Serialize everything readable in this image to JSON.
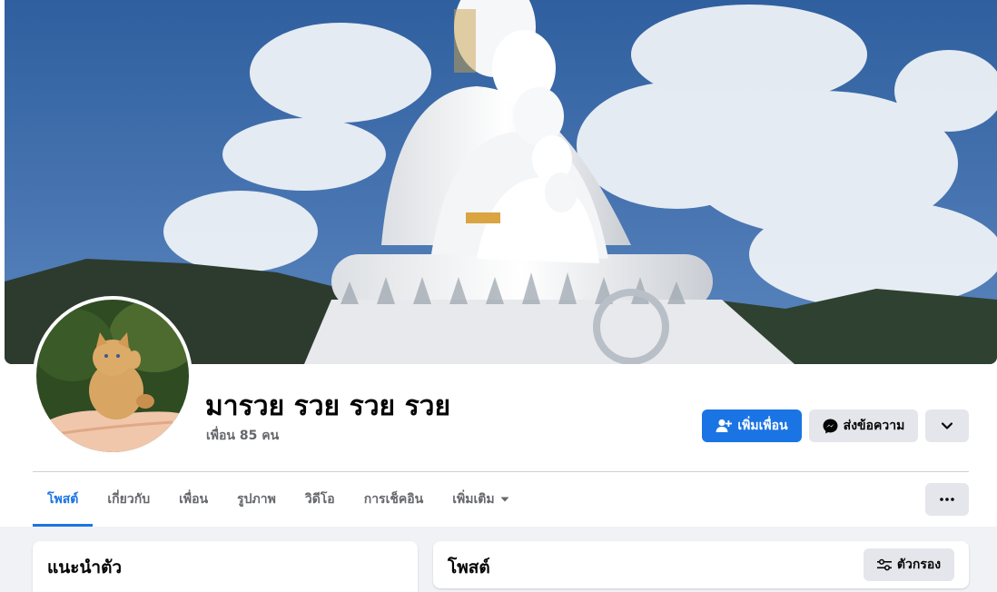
{
  "profile": {
    "name": "มารวย รวย รวย รวย",
    "friends": "เพื่อน 85 คน"
  },
  "actions": {
    "add_friend": "เพิ่มเพื่อน",
    "message": "ส่งข้อความ"
  },
  "tabs": [
    {
      "label": "โพสต์",
      "active": true
    },
    {
      "label": "เกี่ยวกับ",
      "active": false
    },
    {
      "label": "เพื่อน",
      "active": false
    },
    {
      "label": "รูปภาพ",
      "active": false
    },
    {
      "label": "วิดีโอ",
      "active": false
    },
    {
      "label": "การเช็คอิน",
      "active": false
    },
    {
      "label": "เพิ่มเติม",
      "active": false
    }
  ],
  "intro": {
    "title": "แนะนำตัว"
  },
  "posts": {
    "title": "โพสต์",
    "filter_label": "ตัวกรอง"
  },
  "colors": {
    "accent": "#1b74e4",
    "secondary_button": "#e4e6eb",
    "page_background": "#f0f2f5"
  },
  "icons": {
    "add_friend": "person-plus-icon",
    "message": "messenger-icon",
    "dropdown": "chevron-down-icon",
    "more": "ellipsis-icon",
    "filter": "sliders-icon",
    "caret": "caret-down-icon"
  }
}
